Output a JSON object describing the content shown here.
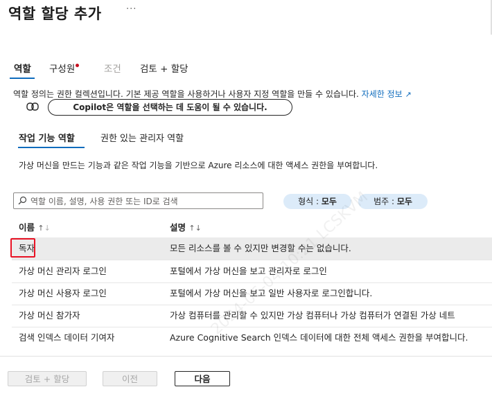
{
  "header": {
    "title": "역할 할당 추가",
    "more_label": "···"
  },
  "tabs": [
    {
      "label": "역할",
      "state": "active"
    },
    {
      "label": "구성원",
      "state": "normal",
      "has_dot": true
    },
    {
      "label": "조건",
      "state": "disabled"
    },
    {
      "label": "검토 + 할당",
      "state": "normal"
    }
  ],
  "description": {
    "text": "역할 정의는 권한 컬렉션입니다. 기본 제공 역할을 사용하거나 사용자 지정 역할을 만들 수 있습니다.",
    "link": "자세한 정보"
  },
  "copilot": {
    "icon": "copilot-icon",
    "label": "Copilot은 역할을 선택하는 데 도움이 될 수 있습니다."
  },
  "role_tabs": [
    {
      "label": "작업 기능 역할",
      "active": true
    },
    {
      "label": "권한 있는 관리자 역할",
      "active": false
    }
  ],
  "info_text": "가상 머신을 만드는 기능과 같은 작업 기능을 기반으로 Azure 리소스에 대한 액세스 권한을 부여합니다.",
  "search": {
    "placeholder": "역할 이름, 설명, 사용 권한 또는 ID로 검색"
  },
  "filters": [
    {
      "label": "형식 :",
      "value": "모두"
    },
    {
      "label": "범주 :",
      "value": "모두"
    }
  ],
  "table": {
    "headers": [
      "이름",
      "설명"
    ],
    "rows": [
      {
        "name": "독자",
        "description": "모든 리소스를 볼 수 있지만 변경할 수는 없습니다.",
        "selected": true
      },
      {
        "name": "가상 머신 관리자 로그인",
        "description": "포털에서 가상 머신을 보고 관리자로 로그인"
      },
      {
        "name": "가상 머신 사용자 로그인",
        "description": "포털에서 가상 머신을 보고 일반 사용자로 로그인합니다."
      },
      {
        "name": "가상 머신 참가자",
        "description": "가상 컴퓨터를 관리할 수 있지만 가상 컴퓨터나 가상 컴퓨터가 연결된 가상 네트"
      },
      {
        "name": "검색 인덱스 데이터 기여자",
        "description": "Azure Cognitive Search 인덱스 데이터에 대한 전체 액세스 권한을 부여합니다."
      }
    ]
  },
  "footer": {
    "review_label": "검토 + 할당",
    "prev_label": "이전",
    "next_label": "다음"
  },
  "watermark": "2024-06-04 10:21 LCSKVM",
  "colors": {
    "accent": "#0f6cbd",
    "highlight": "#e81123",
    "pill_bg": "#dcebf9"
  }
}
